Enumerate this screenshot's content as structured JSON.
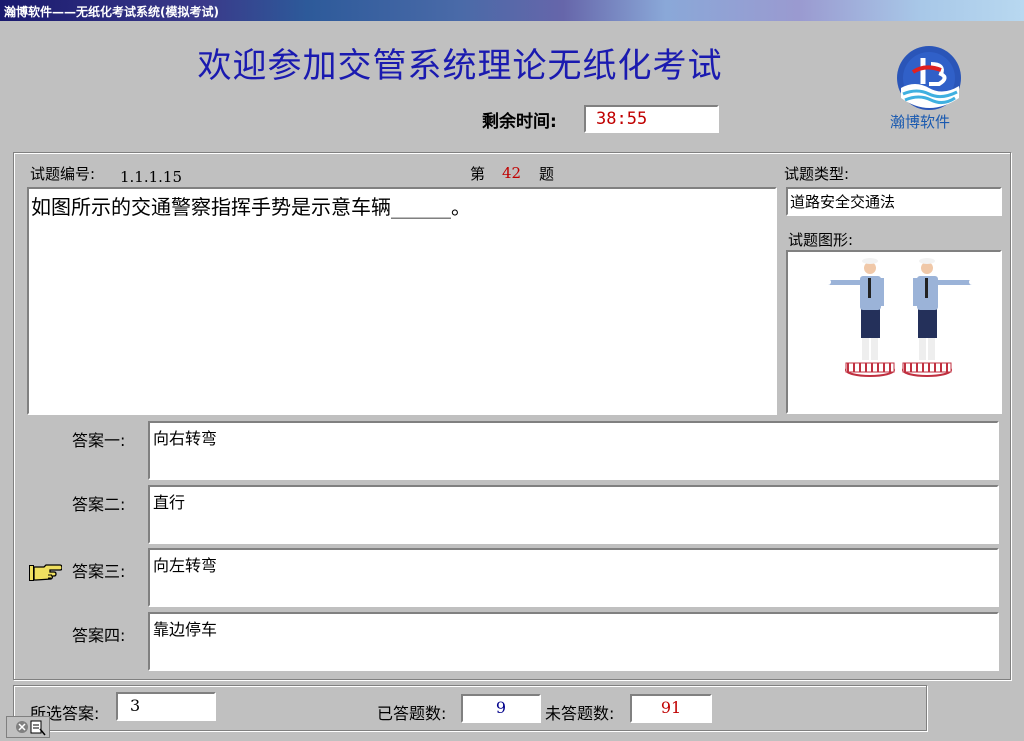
{
  "window": {
    "title": "瀚博软件——无纸化考试系统(模拟考试)"
  },
  "header": {
    "heading": "欢迎参加交管系统理论无纸化考试",
    "timer_label": "剩余时间:",
    "timer_value": "38:55",
    "logo_text": "瀚博软件"
  },
  "question": {
    "id_label": "试题编号:",
    "id_value": "1.1.1.15",
    "number_prefix": "第",
    "number": "42",
    "number_suffix": "题",
    "text": "如图所示的交通警察指挥手势是示意车辆______。",
    "type_label": "试题类型:",
    "type_value": "道路安全交通法",
    "figure_label": "试题图形:"
  },
  "answers": [
    {
      "label": "答案一:",
      "text": "向右转弯"
    },
    {
      "label": "答案二:",
      "text": "直行"
    },
    {
      "label": "答案三:",
      "text": "向左转弯"
    },
    {
      "label": "答案四:",
      "text": "靠边停车"
    }
  ],
  "selected_pointer_index": 3,
  "status": {
    "selected_label": "所选答案:",
    "selected_value": "3",
    "answered_label": "已答题数:",
    "answered_value": "9",
    "unanswered_label": "未答题数:",
    "unanswered_value": "91"
  },
  "colors": {
    "heading": "#1a1ab0",
    "red_value": "#c00000",
    "blue_value": "#00008b"
  }
}
